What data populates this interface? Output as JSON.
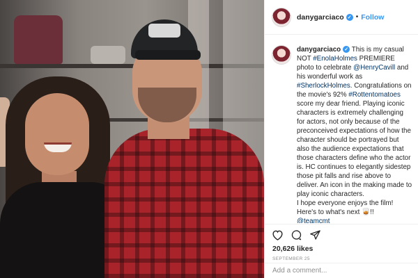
{
  "post": {
    "username": "danygarciaco",
    "verified_mark": "✓",
    "separator": "•",
    "follow_label": "Follow",
    "caption_segments": [
      {
        "text": " This is my casual NOT ",
        "type": "text"
      },
      {
        "text": "#EnolaHolmes",
        "type": "link"
      },
      {
        "text": " PREMIERE photo to celebrate ",
        "type": "text"
      },
      {
        "text": "@HenryCavill",
        "type": "link"
      },
      {
        "text": " and his wonderful work as ",
        "type": "text"
      },
      {
        "text": "#SherlockHolmes",
        "type": "link"
      },
      {
        "text": ". Congratulations on the movie's 92% ",
        "type": "text"
      },
      {
        "text": "#Rottentomatoes",
        "type": "link"
      },
      {
        "text": " score my dear friend. Playing iconic characters is extremely challenging for actors, not only because of the preconceived expectations of how the character should be portrayed but also the audience expectations that those characters define who the actor is. HC continues to elegantly sidestep those pit falls and rise above to deliver. An icon in the making made to play iconic characters.",
        "type": "text"
      }
    ],
    "caption_line2": "I hope everyone enjoys the film!",
    "caption_line3": "Here's to what's next 🥃!!",
    "caption_line4": "@teamcmt",
    "likes": "20,626 likes",
    "date": "SEPTEMBER 25",
    "comment_placeholder": "Add a comment..."
  },
  "colors": {
    "accent": "#3897f0",
    "link": "#003569",
    "text": "#262626",
    "muted": "#8e8e8e"
  },
  "icons": {
    "like": "heart-icon",
    "comment": "comment-icon",
    "share": "share-icon"
  }
}
